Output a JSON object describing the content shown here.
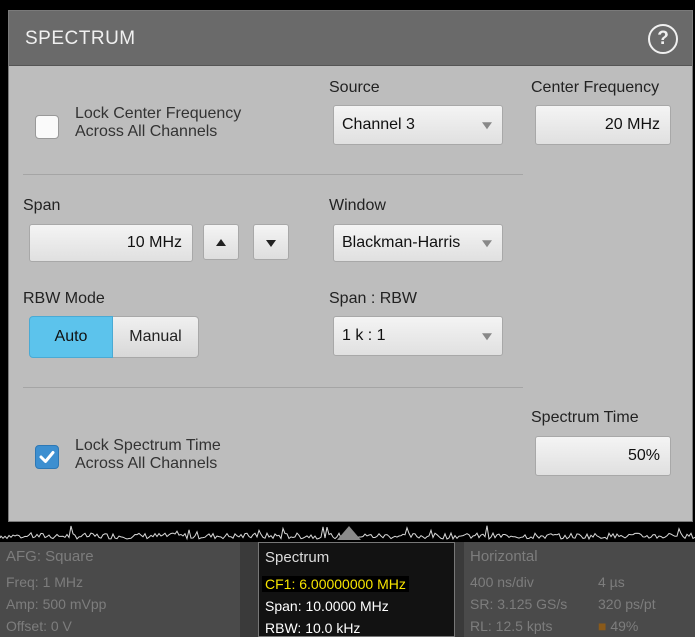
{
  "dialog": {
    "title": "SPECTRUM",
    "help_icon": "help-circle-icon",
    "lock_center": {
      "label_line1": "Lock Center Frequency",
      "label_line2": "Across All Channels",
      "checked": false
    },
    "source": {
      "label": "Source",
      "value": "Channel 3"
    },
    "center_frequency": {
      "label": "Center Frequency",
      "value": "20 MHz"
    },
    "span": {
      "label": "Span",
      "value": "10 MHz"
    },
    "window": {
      "label": "Window",
      "value": "Blackman-Harris"
    },
    "rbw_mode": {
      "label": "RBW Mode",
      "options": [
        "Auto",
        "Manual"
      ],
      "selected": "Auto"
    },
    "span_rbw": {
      "label": "Span : RBW",
      "value": "1 k : 1"
    },
    "spectrum_time": {
      "label": "Spectrum Time",
      "value": "50%"
    },
    "lock_spectrum": {
      "label_line1": "Lock Spectrum Time",
      "label_line2": "Across All Channels",
      "checked": true
    }
  },
  "bottom": {
    "afg": {
      "title": "AFG: Square",
      "freq": "Freq: 1 MHz",
      "amp": "Amp: 500 mVpp",
      "offset": "Offset: 0 V"
    },
    "spectrum": {
      "title": "Spectrum",
      "cf": "CF1: 6.00000000 MHz",
      "span": "Span: 10.0000 MHz",
      "rbw": "RBW: 10.0 kHz"
    },
    "horizontal": {
      "title": "Horizontal",
      "scale": "400 ns/div",
      "duration": "4 µs",
      "sr": "SR: 3.125 GS/s",
      "pt": "320 ps/pt",
      "rl": "RL: 12.5 kpts",
      "pos": "49%"
    }
  },
  "colors": {
    "accent": "#5cc3ec",
    "checkbox": "#3d8fd0",
    "highlight": "#f7e500"
  }
}
